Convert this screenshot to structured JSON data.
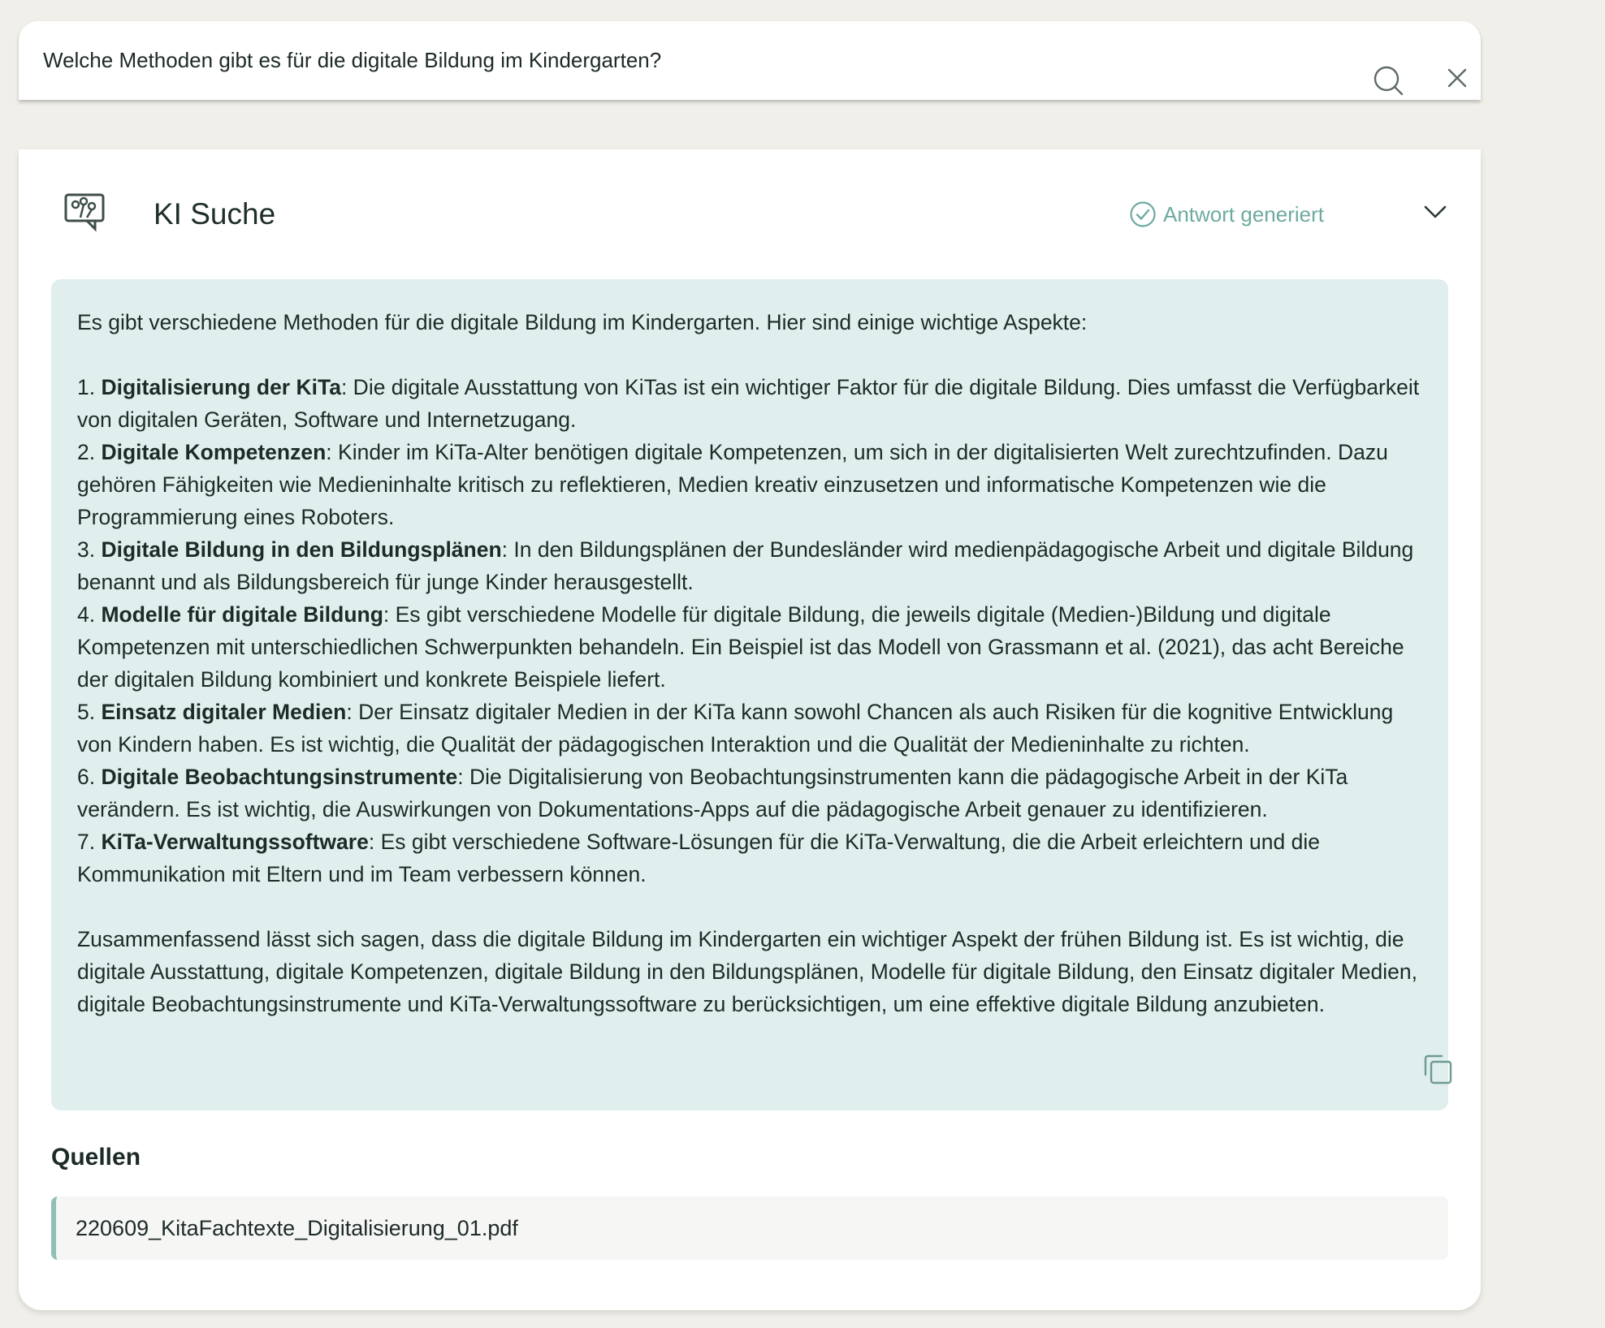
{
  "search": {
    "query": "Welche Methoden gibt es für die digitale Bildung im Kindergarten?"
  },
  "icons": {
    "search": "search-icon",
    "close": "close-icon",
    "brand": "ai-search-icon",
    "status": "check-circle-icon",
    "collapse": "chevron-down-icon",
    "copy": "copy-icon"
  },
  "colors": {
    "background": "#f1efe9",
    "answer_background": "#e0efed",
    "accent": "#6daaa0",
    "text": "#1d2b28"
  },
  "panel": {
    "title": "KI Suche",
    "status": "Antwort generiert"
  },
  "answer": {
    "intro": "Es gibt verschiedene Methoden für die digitale Bildung im Kindergarten. Hier sind einige wichtige Aspekte:",
    "items": [
      {
        "number": "1. ",
        "title": "Digitalisierung der KiTa",
        "text": ": Die digitale Ausstattung von KiTas ist ein wichtiger Faktor für die digitale Bildung. Dies umfasst die Verfügbarkeit von digitalen Geräten, Software und Internetzugang."
      },
      {
        "number": "2. ",
        "title": "Digitale Kompetenzen",
        "text": ": Kinder im KiTa-Alter benötigen digitale Kompetenzen, um sich in der digitalisierten Welt zurechtzufinden. Dazu gehören Fähigkeiten wie Medieninhalte kritisch zu reflektieren, Medien kreativ einzusetzen und informatische Kompetenzen wie die Programmierung eines Roboters."
      },
      {
        "number": "3. ",
        "title": "Digitale Bildung in den Bildungsplänen",
        "text": ": In den Bildungsplänen der Bundesländer wird medienpädagogische Arbeit und digitale Bildung benannt und als Bildungsbereich für junge Kinder herausgestellt."
      },
      {
        "number": "4. ",
        "title": "Modelle für digitale Bildung",
        "text": ": Es gibt verschiedene Modelle für digitale Bildung, die jeweils digitale (Medien-)Bildung und digitale Kompetenzen mit unterschiedlichen Schwerpunkten behandeln. Ein Beispiel ist das Modell von Grassmann et al. (2021), das acht Bereiche der digitalen Bildung kombiniert und konkrete Beispiele liefert."
      },
      {
        "number": "5. ",
        "title": "Einsatz digitaler Medien",
        "text": ": Der Einsatz digitaler Medien in der KiTa kann sowohl Chancen als auch Risiken für die kognitive Entwicklung von Kindern haben. Es ist wichtig, die Qualität der pädagogischen Interaktion und die Qualität der Medieninhalte zu richten."
      },
      {
        "number": "6. ",
        "title": "Digitale Beobachtungsinstrumente",
        "text": ": Die Digitalisierung von Beobachtungsinstrumenten kann die pädagogische Arbeit in der KiTa verändern. Es ist wichtig, die Auswirkungen von Dokumentations-Apps auf die pädagogische Arbeit genauer zu identifizieren."
      },
      {
        "number": "7. ",
        "title": "KiTa-Verwaltungssoftware",
        "text": ": Es gibt verschiedene Software-Lösungen für die KiTa-Verwaltung, die die Arbeit erleichtern und die Kommunikation mit Eltern und im Team verbessern können."
      }
    ],
    "summary": "Zusammenfassend lässt sich sagen, dass die digitale Bildung im Kindergarten ein wichtiger Aspekt der frühen Bildung ist. Es ist wichtig, die digitale Ausstattung, digitale Kompetenzen, digitale Bildung in den Bildungsplänen, Modelle für digitale Bildung, den Einsatz digitaler Medien, digitale Beobachtungsinstrumente und KiTa-Verwaltungssoftware zu berücksichtigen, um eine effektive digitale Bildung anzubieten."
  },
  "sources": {
    "heading": "Quellen",
    "items": [
      {
        "label": "220609_KitaFachtexte_Digitalisierung_01.pdf"
      }
    ]
  }
}
